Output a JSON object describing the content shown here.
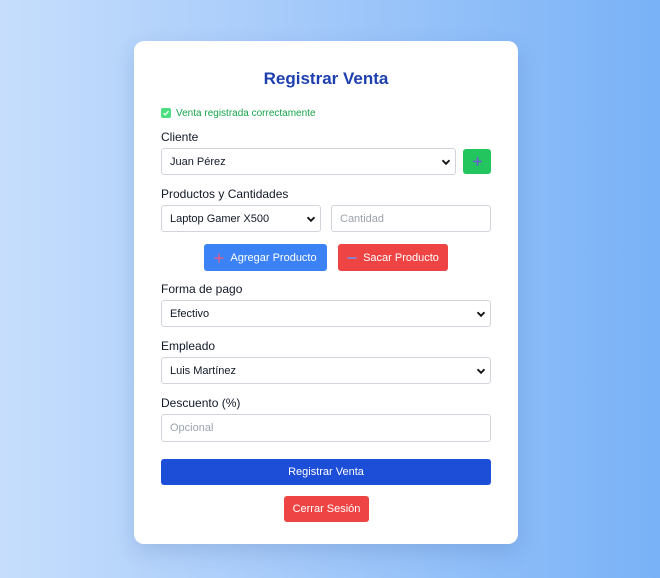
{
  "form": {
    "title": "Registrar Venta",
    "success_message": "Venta registrada correctamente",
    "cliente_label": "Cliente",
    "cliente_value": "Juan Pérez",
    "productos_label": "Productos y Cantidades",
    "producto_value": "Laptop Gamer X500",
    "cantidad_placeholder": "Cantidad",
    "agregar_label": "Agregar Producto",
    "sacar_label": "Sacar Producto",
    "forma_pago_label": "Forma de pago",
    "forma_pago_value": "Efectivo",
    "empleado_label": "Empleado",
    "empleado_value": "Luis Martínez",
    "descuento_label": "Descuento (%)",
    "descuento_placeholder": "Opcional",
    "submit_label": "Registrar Venta",
    "logout_label": "Cerrar Sesión"
  },
  "colors": {
    "title": "#1e40af",
    "success": "#16a34a",
    "primary": "#3b82f6",
    "danger": "#ef4444",
    "add": "#22c55e",
    "submit": "#1d4ed8"
  },
  "icons": {
    "success": "check-icon",
    "add_client": "plus-icon",
    "agregar": "plus-icon",
    "sacar": "minus-icon",
    "select": "chevron-down-icon"
  }
}
